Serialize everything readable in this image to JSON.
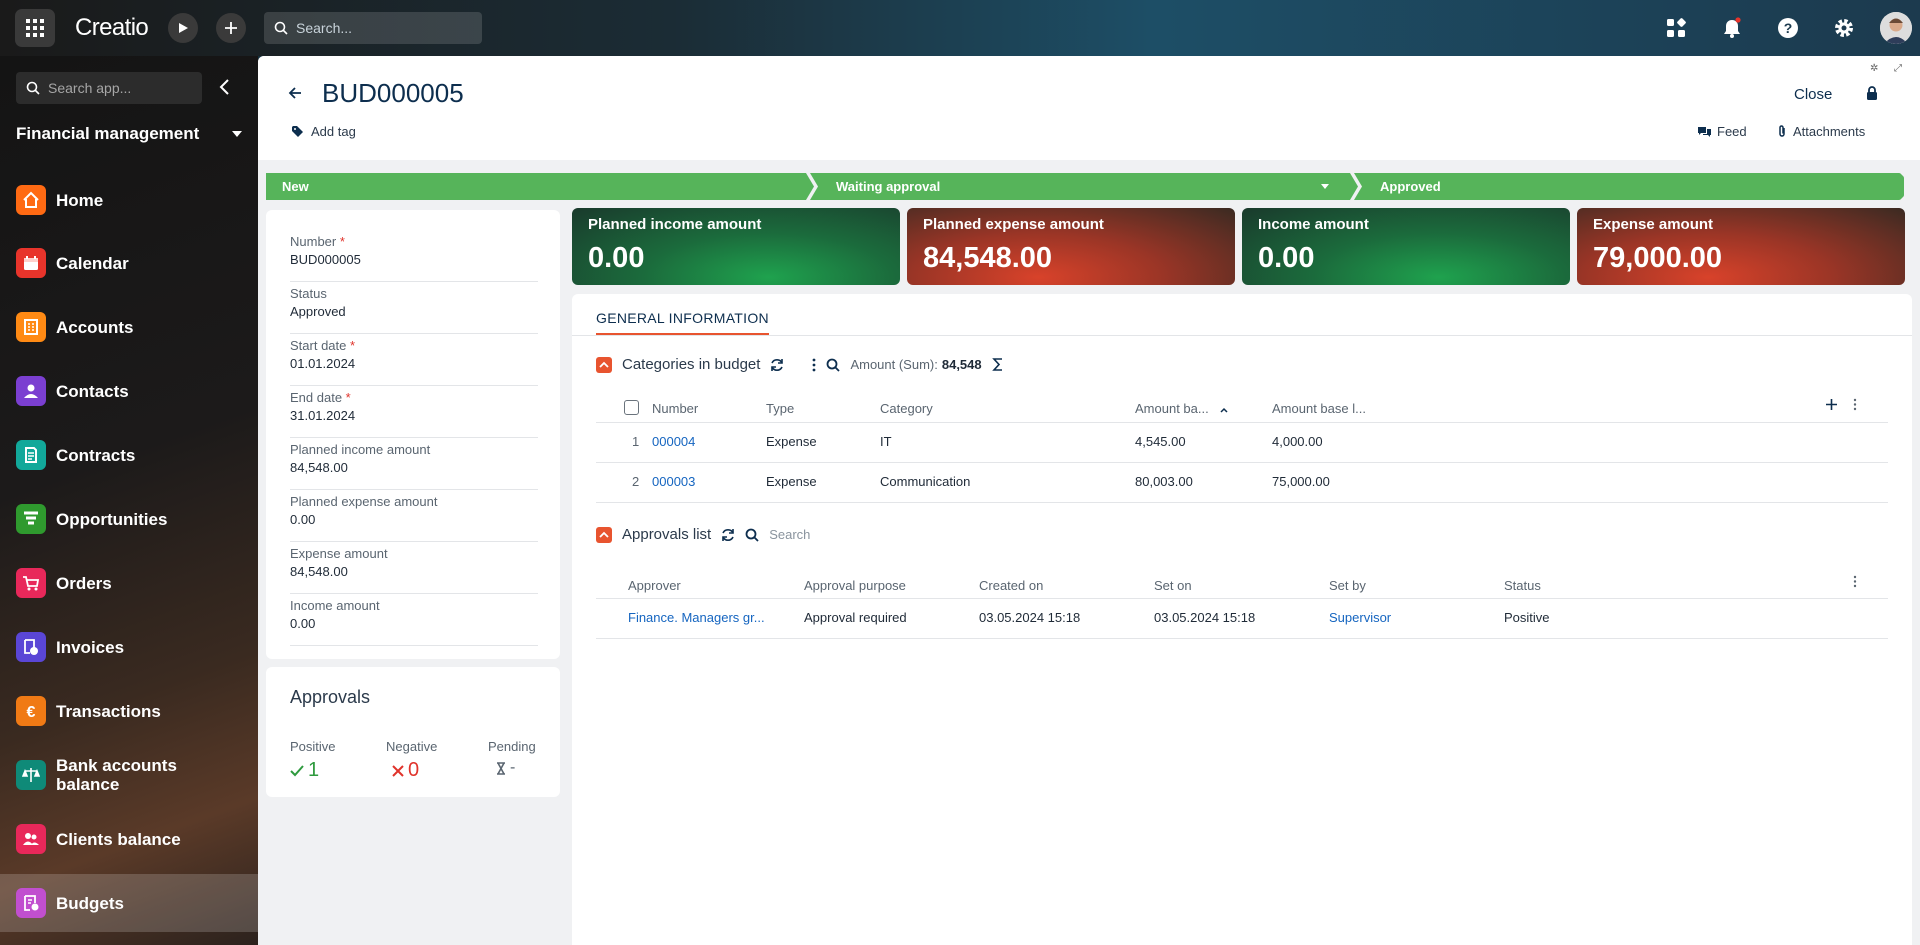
{
  "topbar": {
    "logo": "Creatio",
    "search_placeholder": "Search..."
  },
  "sidebar": {
    "search_placeholder": "Search app...",
    "workspace": "Financial management",
    "items": [
      {
        "label": "Home",
        "icon": "home-icon",
        "color": "#ff6a13"
      },
      {
        "label": "Calendar",
        "icon": "calendar-icon",
        "color": "#e8342b"
      },
      {
        "label": "Accounts",
        "icon": "accounts-icon",
        "color": "#ff8a14"
      },
      {
        "label": "Contacts",
        "icon": "contacts-icon",
        "color": "#7b3fd1"
      },
      {
        "label": "Contracts",
        "icon": "contracts-icon",
        "color": "#12a89a"
      },
      {
        "label": "Opportunities",
        "icon": "opportunities-icon",
        "color": "#2f9a2e"
      },
      {
        "label": "Orders",
        "icon": "orders-icon",
        "color": "#e8285a"
      },
      {
        "label": "Invoices",
        "icon": "invoices-icon",
        "color": "#5a46d6"
      },
      {
        "label": "Transactions",
        "icon": "transactions-icon",
        "color": "#f07a15"
      },
      {
        "label": "Bank accounts balance",
        "icon": "bank-balance-icon",
        "color": "#0f8a78"
      },
      {
        "label": "Clients balance",
        "icon": "clients-balance-icon",
        "color": "#e8285a"
      },
      {
        "label": "Budgets",
        "icon": "budgets-icon",
        "color": "#c14fcf",
        "active": true
      }
    ]
  },
  "header": {
    "title": "BUD000005",
    "add_tag": "Add tag",
    "close": "Close",
    "feed": "Feed",
    "attachments": "Attachments"
  },
  "stages": [
    {
      "label": "New"
    },
    {
      "label": "Waiting approval"
    },
    {
      "label": "Approved"
    }
  ],
  "fields": [
    {
      "label": "Number",
      "required": true,
      "value": "BUD000005"
    },
    {
      "label": "Status",
      "required": false,
      "value": "Approved"
    },
    {
      "label": "Start date",
      "required": true,
      "value": "01.01.2024"
    },
    {
      "label": "End date",
      "required": true,
      "value": "31.01.2024"
    },
    {
      "label": "Planned income amount",
      "required": false,
      "value": "84,548.00"
    },
    {
      "label": "Planned expense amount",
      "required": false,
      "value": "0.00"
    },
    {
      "label": "Expense amount",
      "required": false,
      "value": "84,548.00"
    },
    {
      "label": "Income amount",
      "required": false,
      "value": "0.00"
    }
  ],
  "approvals": {
    "title": "Approvals",
    "positive_label": "Positive",
    "positive_value": "1",
    "negative_label": "Negative",
    "negative_value": "0",
    "pending_label": "Pending",
    "pending_value": "-"
  },
  "kpis": [
    {
      "label": "Planned income amount",
      "value": "0.00",
      "tone": "green"
    },
    {
      "label": "Planned expense amount",
      "value": "84,548.00",
      "tone": "red"
    },
    {
      "label": "Income amount",
      "value": "0.00",
      "tone": "green"
    },
    {
      "label": "Expense amount",
      "value": "79,000.00",
      "tone": "red"
    }
  ],
  "tab": "GENERAL INFORMATION",
  "categories": {
    "title": "Categories in budget",
    "sum_label": "Amount (Sum):",
    "sum_value": "84,548",
    "columns": [
      "Number",
      "Type",
      "Category",
      "Amount ba...",
      "Amount base l..."
    ],
    "rows": [
      {
        "idx": "1",
        "number": "000004",
        "type": "Expense",
        "category": "IT",
        "amount_base": "4,545.00",
        "amount_base_l": "4,000.00"
      },
      {
        "idx": "2",
        "number": "000003",
        "type": "Expense",
        "category": "Communication",
        "amount_base": "80,003.00",
        "amount_base_l": "75,000.00"
      }
    ]
  },
  "approvals_list": {
    "title": "Approvals list",
    "search_placeholder": "Search",
    "columns": [
      "Approver",
      "Approval purpose",
      "Created on",
      "Set on",
      "Set by",
      "Status"
    ],
    "rows": [
      {
        "approver": "Finance. Managers gr...",
        "purpose": "Approval required",
        "created_on": "03.05.2024 15:18",
        "set_on": "03.05.2024 15:18",
        "set_by": "Supervisor",
        "status": "Positive"
      }
    ]
  }
}
